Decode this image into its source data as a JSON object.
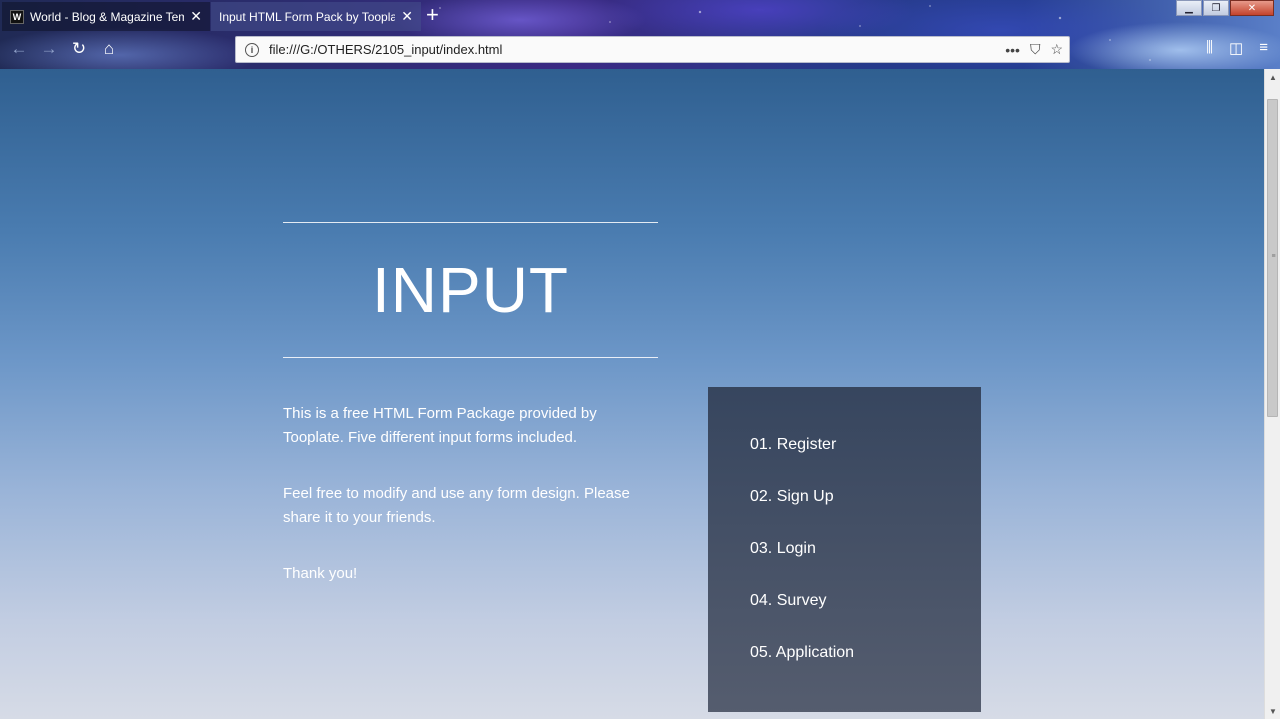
{
  "browser": {
    "tabs": [
      {
        "favicon": "W",
        "title": "World - Blog & Magazine Temp",
        "active": false
      },
      {
        "title": "Input HTML Form Pack by Tooplate",
        "active": true
      }
    ],
    "new_tab_icon": "+",
    "url": "file:///G:/OTHERS/2105_input/index.html",
    "window_buttons": {
      "minimize": "▁",
      "restore": "❐",
      "close": "✕"
    },
    "icons": {
      "back": "back-arrow-icon",
      "forward": "forward-arrow-icon",
      "reload": "reload-icon",
      "home": "home-icon",
      "info": "info-icon",
      "page_actions": "more-icon",
      "pocket": "pocket-icon",
      "bookmark": "star-icon",
      "library": "library-icon",
      "sidebar": "sidebar-icon",
      "menu": "hamburger-icon"
    }
  },
  "page": {
    "title": "INPUT",
    "paragraphs": [
      "This is a free HTML Form Package provided by Tooplate. Five different input forms included.",
      "Feel free to modify and use any form design. Please share it to your friends.",
      "Thank you!"
    ],
    "menu": [
      "01. Register",
      "02. Sign Up",
      "03. Login",
      "04. Survey",
      "05. Application"
    ]
  }
}
